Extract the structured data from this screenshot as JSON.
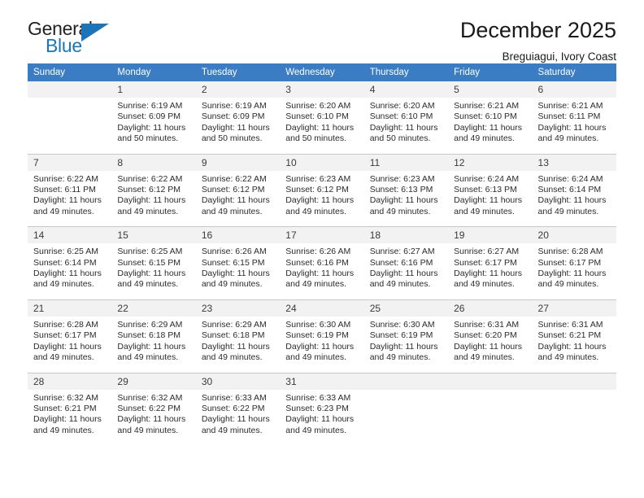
{
  "logo": {
    "general_text": "General",
    "blue_text": "Blue",
    "triangle_color": "#1b75bb"
  },
  "header": {
    "title": "December 2025",
    "subtitle": "Breguiagui, Ivory Coast"
  },
  "theme": {
    "header_bg": "#3b7dc4",
    "daynum_bg": "#f2f2f2",
    "separator": "#c8c8c8",
    "text": "#1a1a1a"
  },
  "calendar": {
    "weekday_headers": [
      "Sunday",
      "Monday",
      "Tuesday",
      "Wednesday",
      "Thursday",
      "Friday",
      "Saturday"
    ],
    "weeks": [
      {
        "numbers": [
          "",
          "1",
          "2",
          "3",
          "4",
          "5",
          "6"
        ],
        "details": [
          {
            "sunrise": "",
            "sunset": "",
            "daylight_line1": "",
            "daylight_line2": ""
          },
          {
            "sunrise": "Sunrise: 6:19 AM",
            "sunset": "Sunset: 6:09 PM",
            "daylight_line1": "Daylight: 11 hours",
            "daylight_line2": "and 50 minutes."
          },
          {
            "sunrise": "Sunrise: 6:19 AM",
            "sunset": "Sunset: 6:09 PM",
            "daylight_line1": "Daylight: 11 hours",
            "daylight_line2": "and 50 minutes."
          },
          {
            "sunrise": "Sunrise: 6:20 AM",
            "sunset": "Sunset: 6:10 PM",
            "daylight_line1": "Daylight: 11 hours",
            "daylight_line2": "and 50 minutes."
          },
          {
            "sunrise": "Sunrise: 6:20 AM",
            "sunset": "Sunset: 6:10 PM",
            "daylight_line1": "Daylight: 11 hours",
            "daylight_line2": "and 50 minutes."
          },
          {
            "sunrise": "Sunrise: 6:21 AM",
            "sunset": "Sunset: 6:10 PM",
            "daylight_line1": "Daylight: 11 hours",
            "daylight_line2": "and 49 minutes."
          },
          {
            "sunrise": "Sunrise: 6:21 AM",
            "sunset": "Sunset: 6:11 PM",
            "daylight_line1": "Daylight: 11 hours",
            "daylight_line2": "and 49 minutes."
          }
        ]
      },
      {
        "numbers": [
          "7",
          "8",
          "9",
          "10",
          "11",
          "12",
          "13"
        ],
        "details": [
          {
            "sunrise": "Sunrise: 6:22 AM",
            "sunset": "Sunset: 6:11 PM",
            "daylight_line1": "Daylight: 11 hours",
            "daylight_line2": "and 49 minutes."
          },
          {
            "sunrise": "Sunrise: 6:22 AM",
            "sunset": "Sunset: 6:12 PM",
            "daylight_line1": "Daylight: 11 hours",
            "daylight_line2": "and 49 minutes."
          },
          {
            "sunrise": "Sunrise: 6:22 AM",
            "sunset": "Sunset: 6:12 PM",
            "daylight_line1": "Daylight: 11 hours",
            "daylight_line2": "and 49 minutes."
          },
          {
            "sunrise": "Sunrise: 6:23 AM",
            "sunset": "Sunset: 6:12 PM",
            "daylight_line1": "Daylight: 11 hours",
            "daylight_line2": "and 49 minutes."
          },
          {
            "sunrise": "Sunrise: 6:23 AM",
            "sunset": "Sunset: 6:13 PM",
            "daylight_line1": "Daylight: 11 hours",
            "daylight_line2": "and 49 minutes."
          },
          {
            "sunrise": "Sunrise: 6:24 AM",
            "sunset": "Sunset: 6:13 PM",
            "daylight_line1": "Daylight: 11 hours",
            "daylight_line2": "and 49 minutes."
          },
          {
            "sunrise": "Sunrise: 6:24 AM",
            "sunset": "Sunset: 6:14 PM",
            "daylight_line1": "Daylight: 11 hours",
            "daylight_line2": "and 49 minutes."
          }
        ]
      },
      {
        "numbers": [
          "14",
          "15",
          "16",
          "17",
          "18",
          "19",
          "20"
        ],
        "details": [
          {
            "sunrise": "Sunrise: 6:25 AM",
            "sunset": "Sunset: 6:14 PM",
            "daylight_line1": "Daylight: 11 hours",
            "daylight_line2": "and 49 minutes."
          },
          {
            "sunrise": "Sunrise: 6:25 AM",
            "sunset": "Sunset: 6:15 PM",
            "daylight_line1": "Daylight: 11 hours",
            "daylight_line2": "and 49 minutes."
          },
          {
            "sunrise": "Sunrise: 6:26 AM",
            "sunset": "Sunset: 6:15 PM",
            "daylight_line1": "Daylight: 11 hours",
            "daylight_line2": "and 49 minutes."
          },
          {
            "sunrise": "Sunrise: 6:26 AM",
            "sunset": "Sunset: 6:16 PM",
            "daylight_line1": "Daylight: 11 hours",
            "daylight_line2": "and 49 minutes."
          },
          {
            "sunrise": "Sunrise: 6:27 AM",
            "sunset": "Sunset: 6:16 PM",
            "daylight_line1": "Daylight: 11 hours",
            "daylight_line2": "and 49 minutes."
          },
          {
            "sunrise": "Sunrise: 6:27 AM",
            "sunset": "Sunset: 6:17 PM",
            "daylight_line1": "Daylight: 11 hours",
            "daylight_line2": "and 49 minutes."
          },
          {
            "sunrise": "Sunrise: 6:28 AM",
            "sunset": "Sunset: 6:17 PM",
            "daylight_line1": "Daylight: 11 hours",
            "daylight_line2": "and 49 minutes."
          }
        ]
      },
      {
        "numbers": [
          "21",
          "22",
          "23",
          "24",
          "25",
          "26",
          "27"
        ],
        "details": [
          {
            "sunrise": "Sunrise: 6:28 AM",
            "sunset": "Sunset: 6:17 PM",
            "daylight_line1": "Daylight: 11 hours",
            "daylight_line2": "and 49 minutes."
          },
          {
            "sunrise": "Sunrise: 6:29 AM",
            "sunset": "Sunset: 6:18 PM",
            "daylight_line1": "Daylight: 11 hours",
            "daylight_line2": "and 49 minutes."
          },
          {
            "sunrise": "Sunrise: 6:29 AM",
            "sunset": "Sunset: 6:18 PM",
            "daylight_line1": "Daylight: 11 hours",
            "daylight_line2": "and 49 minutes."
          },
          {
            "sunrise": "Sunrise: 6:30 AM",
            "sunset": "Sunset: 6:19 PM",
            "daylight_line1": "Daylight: 11 hours",
            "daylight_line2": "and 49 minutes."
          },
          {
            "sunrise": "Sunrise: 6:30 AM",
            "sunset": "Sunset: 6:19 PM",
            "daylight_line1": "Daylight: 11 hours",
            "daylight_line2": "and 49 minutes."
          },
          {
            "sunrise": "Sunrise: 6:31 AM",
            "sunset": "Sunset: 6:20 PM",
            "daylight_line1": "Daylight: 11 hours",
            "daylight_line2": "and 49 minutes."
          },
          {
            "sunrise": "Sunrise: 6:31 AM",
            "sunset": "Sunset: 6:21 PM",
            "daylight_line1": "Daylight: 11 hours",
            "daylight_line2": "and 49 minutes."
          }
        ]
      },
      {
        "numbers": [
          "28",
          "29",
          "30",
          "31",
          "",
          "",
          ""
        ],
        "details": [
          {
            "sunrise": "Sunrise: 6:32 AM",
            "sunset": "Sunset: 6:21 PM",
            "daylight_line1": "Daylight: 11 hours",
            "daylight_line2": "and 49 minutes."
          },
          {
            "sunrise": "Sunrise: 6:32 AM",
            "sunset": "Sunset: 6:22 PM",
            "daylight_line1": "Daylight: 11 hours",
            "daylight_line2": "and 49 minutes."
          },
          {
            "sunrise": "Sunrise: 6:33 AM",
            "sunset": "Sunset: 6:22 PM",
            "daylight_line1": "Daylight: 11 hours",
            "daylight_line2": "and 49 minutes."
          },
          {
            "sunrise": "Sunrise: 6:33 AM",
            "sunset": "Sunset: 6:23 PM",
            "daylight_line1": "Daylight: 11 hours",
            "daylight_line2": "and 49 minutes."
          },
          {
            "sunrise": "",
            "sunset": "",
            "daylight_line1": "",
            "daylight_line2": ""
          },
          {
            "sunrise": "",
            "sunset": "",
            "daylight_line1": "",
            "daylight_line2": ""
          },
          {
            "sunrise": "",
            "sunset": "",
            "daylight_line1": "",
            "daylight_line2": ""
          }
        ]
      }
    ]
  }
}
